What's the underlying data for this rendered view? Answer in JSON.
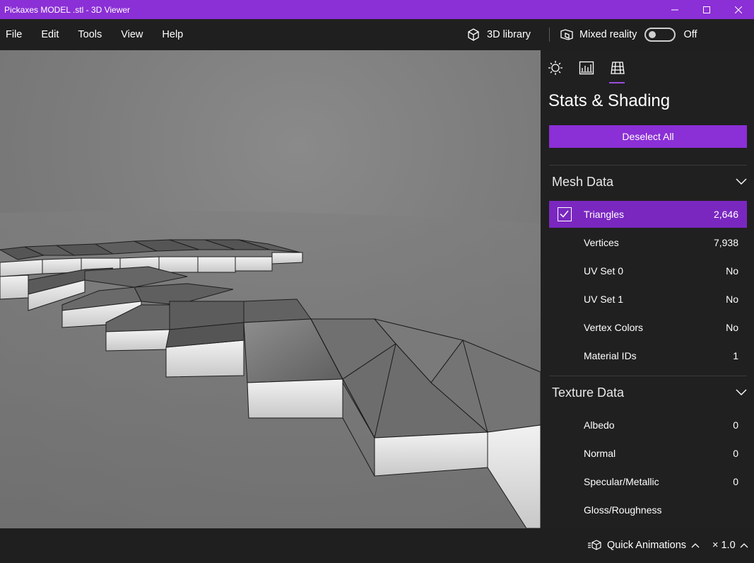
{
  "window": {
    "title": "Pickaxes MODEL .stl - 3D Viewer",
    "minimize": "—",
    "maximize": "☐",
    "close": "✕"
  },
  "menu": {
    "items": [
      "File",
      "Edit",
      "Tools",
      "View",
      "Help"
    ],
    "library_label": "3D library",
    "mixed_reality_label": "Mixed reality",
    "toggle_state": "Off"
  },
  "panel": {
    "tabs": [
      "lighting-icon",
      "stats-icon",
      "grid-icon"
    ],
    "title": "Stats & Shading",
    "deselect_label": "Deselect All",
    "mesh_section": "Mesh Data",
    "mesh_rows": [
      {
        "label": "Triangles",
        "value": "2,646",
        "checked": true
      },
      {
        "label": "Vertices",
        "value": "7,938"
      },
      {
        "label": "UV Set 0",
        "value": "No"
      },
      {
        "label": "UV Set 1",
        "value": "No"
      },
      {
        "label": "Vertex Colors",
        "value": "No"
      },
      {
        "label": "Material IDs",
        "value": "1"
      }
    ],
    "texture_section": "Texture Data",
    "texture_rows": [
      {
        "label": "Albedo",
        "value": "0"
      },
      {
        "label": "Normal",
        "value": "0"
      },
      {
        "label": "Specular/Metallic",
        "value": "0"
      },
      {
        "label": "Gloss/Roughness",
        "value": ""
      }
    ]
  },
  "bottom": {
    "quick_animations": "Quick Animations",
    "zoom": "× 1.0"
  },
  "colors": {
    "accent": "#8b2fd6",
    "background": "#1f1f1f",
    "viewport": "#7a7a7a"
  }
}
